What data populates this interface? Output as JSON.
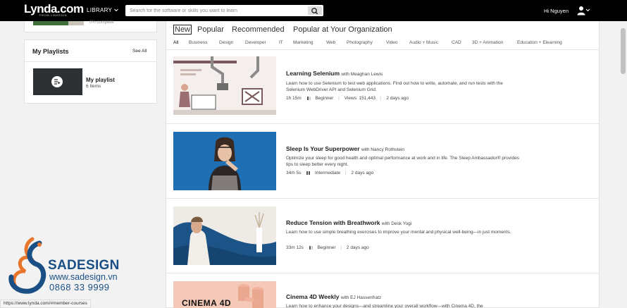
{
  "header": {
    "logo_brand": "Lynda.com",
    "logo_sub": "FROM LINKEDIN",
    "library_label": "LIBRARY",
    "search_placeholder": "Search for the software or skills you want to learn",
    "user_greeting": "Hi Nguyen"
  },
  "left": {
    "partial_card_text": "0% complete",
    "playlists": {
      "title": "My Playlists",
      "see_all": "See All",
      "items": [
        {
          "name": "My playlist",
          "count": "6 Items"
        }
      ]
    }
  },
  "tabs": [
    "New",
    "Popular",
    "Recommended",
    "Popular at Your Organization"
  ],
  "active_tab": "New",
  "filters": [
    "All",
    "Business",
    "Design",
    "Developer",
    "IT",
    "Marketing",
    "Web",
    "Photography",
    "Video",
    "Audio + Music",
    "CAD",
    "3D + Animation",
    "Education + Elearning"
  ],
  "active_filter": "All",
  "courses": [
    {
      "title": "Learning Selenium",
      "author": "with Meaghan Lewis",
      "description": "Learn how to use Selenium to test web applications. Find out how to write, automate, and run tests with the Selenium WebDriver API and Selenium Grid.",
      "duration": "1h 15m",
      "level": "Beginner",
      "views": "Views: 151,443",
      "date": "2 days ago"
    },
    {
      "title": "Sleep Is Your Superpower",
      "author": "with Nancy Rothstein",
      "description": "Optimize your sleep for good health and optimal performance at work and in life. The Sleep Ambassador® provides tips to sleep better every night.",
      "duration": "34m 5s",
      "level": "Intermediate",
      "date": "2 days ago"
    },
    {
      "title": "Reduce Tension with Breathwork",
      "author": "with Desk Yogi",
      "description": "Learn how to use simple breathing exercises to improve your mental and physical well-being—in just moments.",
      "duration": "33m 12s",
      "level": "Beginner",
      "date": "2 days ago"
    },
    {
      "title": "Cinema 4D Weekly",
      "author": "with EJ Hassenfratz",
      "description": "Learn how to enhance your designs—and streamline your overall workflow—with Cinema 4D, the",
      "thumb_text": "CINEMA 4D"
    }
  ],
  "status_url": "https://www.lynda.com/#member-courses",
  "watermark": {
    "name": "SADESIGN",
    "url": "www.sadesign.vn",
    "phone": "0868 33 9999"
  },
  "colors": {
    "topbar": "#000000",
    "selenium_thumb": "#f4efec",
    "sleep_thumb": "#1f6fb5",
    "breath_thumb": "#1c5488",
    "cinema_thumb": "#f5c9b8",
    "watermark_blue": "#1a4f86",
    "watermark_orange": "#e8762b"
  }
}
